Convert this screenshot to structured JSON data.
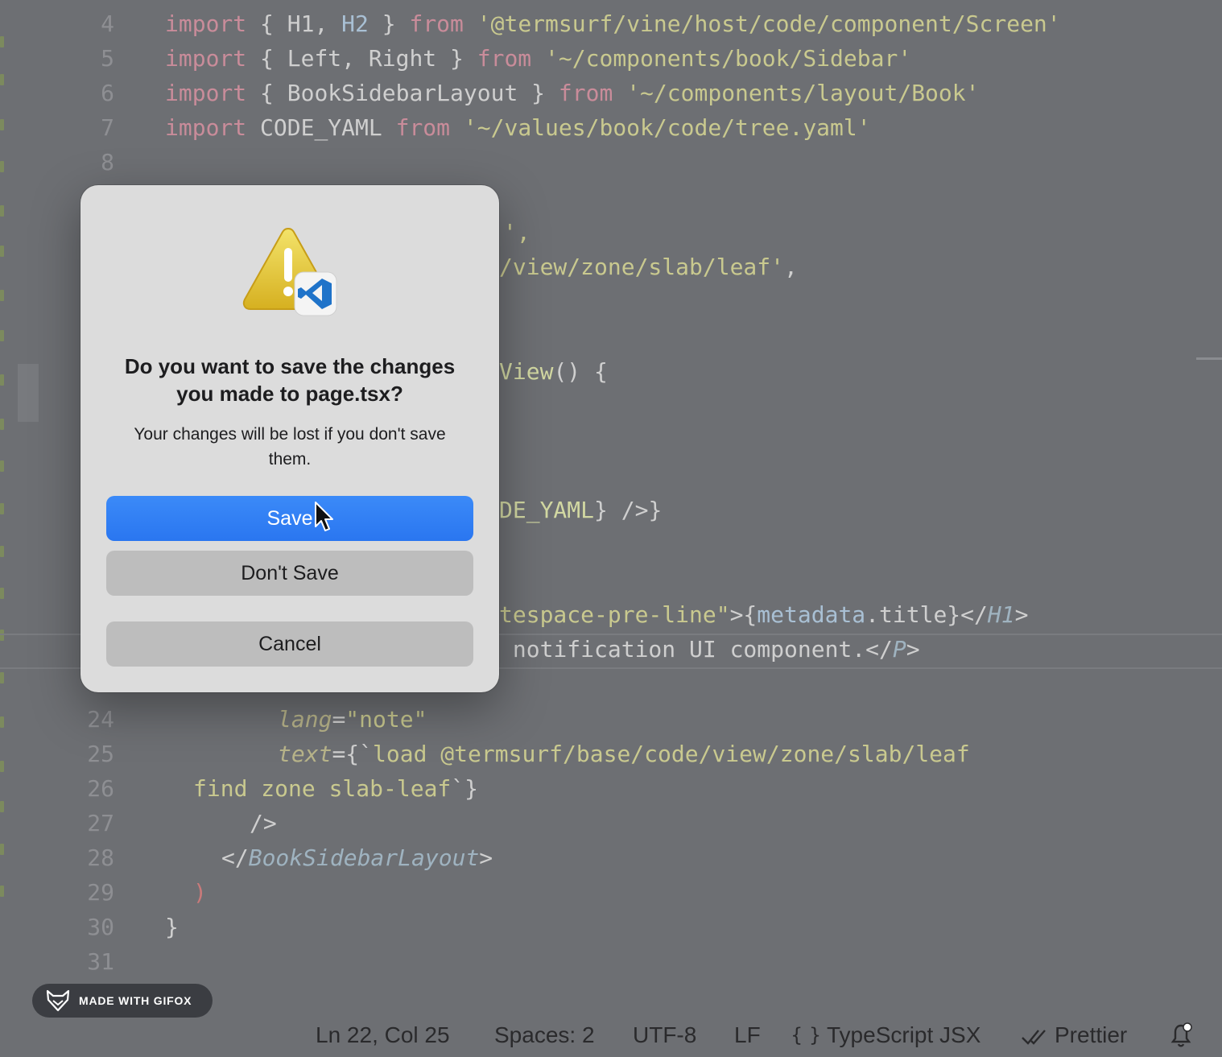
{
  "editor": {
    "lines": [
      {
        "num": "4",
        "segments": [
          [
            "kw",
            "import"
          ],
          [
            "plain",
            " { H1, "
          ],
          [
            "obj",
            "H2"
          ],
          [
            "plain",
            " } "
          ],
          [
            "kw",
            "from"
          ],
          [
            "plain",
            " "
          ],
          [
            "str",
            "'@termsurf/vine/host/code/component/Screen'"
          ]
        ]
      },
      {
        "num": "5",
        "segments": [
          [
            "kw",
            "import"
          ],
          [
            "plain",
            " { Left, Right } "
          ],
          [
            "kw",
            "from"
          ],
          [
            "plain",
            " "
          ],
          [
            "str",
            "'~/components/book/Sidebar'"
          ]
        ]
      },
      {
        "num": "6",
        "segments": [
          [
            "kw",
            "import"
          ],
          [
            "plain",
            " { BookSidebarLayout } "
          ],
          [
            "kw",
            "from"
          ],
          [
            "plain",
            " "
          ],
          [
            "str",
            "'~/components/layout/Book'"
          ]
        ]
      },
      {
        "num": "7",
        "segments": [
          [
            "kw",
            "import"
          ],
          [
            "plain",
            " CODE_YAML "
          ],
          [
            "kw",
            "from"
          ],
          [
            "plain",
            " "
          ],
          [
            "str",
            "'~/values/book/code/tree.yaml'"
          ]
        ]
      },
      {
        "num": "8",
        "segments": []
      },
      {
        "num": "",
        "segments": [
          [
            "str",
            "',"
          ]
        ],
        "indent": 420
      },
      {
        "num": "",
        "segments": [
          [
            "str",
            "/view/zone/slab/leaf'"
          ],
          [
            "plain",
            ","
          ]
        ],
        "indent": 415
      },
      {
        "num": "",
        "segments": [
          [
            "fn",
            "View"
          ],
          [
            "plain",
            "() {"
          ]
        ],
        "indent": 415
      },
      {
        "num": "",
        "segments": [
          [
            "fn",
            "DE_YAML"
          ],
          [
            "plain",
            "} />}"
          ]
        ],
        "indent": 415
      },
      {
        "num": "",
        "segments": [
          [
            "str",
            "tespace-pre-line\""
          ],
          [
            "plain",
            ">{"
          ],
          [
            "obj",
            "metadata"
          ],
          [
            "plain",
            ".title}</"
          ],
          [
            "tag",
            "H1"
          ],
          [
            "plain",
            ">"
          ]
        ],
        "indent": 415
      },
      {
        "num": "",
        "segments": [
          [
            "plain",
            " notification UI component.</"
          ],
          [
            "tag",
            "P"
          ],
          [
            "plain",
            ">"
          ]
        ],
        "indent": 415
      },
      {
        "num": "24",
        "segments": [
          [
            "attr",
            "lang"
          ],
          [
            "plain",
            "="
          ],
          [
            "str",
            "\"note\""
          ]
        ],
        "indent": 140
      },
      {
        "num": "25",
        "segments": [
          [
            "attr",
            "text"
          ],
          [
            "plain",
            "={`"
          ],
          [
            "str",
            "load @termsurf/base/code/view/zone/slab/leaf"
          ]
        ],
        "indent": 140
      },
      {
        "num": "26",
        "segments": [
          [
            "str",
            "find zone slab-leaf"
          ],
          [
            "plain",
            "`}"
          ]
        ],
        "indent": 35
      },
      {
        "num": "27",
        "segments": [
          [
            "plain",
            "/>"
          ]
        ],
        "indent": 105
      },
      {
        "num": "28",
        "segments": [
          [
            "plain",
            "</"
          ],
          [
            "tag",
            "BookSidebarLayout"
          ],
          [
            "plain",
            ">"
          ]
        ],
        "indent": 70
      },
      {
        "num": "29",
        "segments": [
          [
            "red",
            ")"
          ]
        ],
        "indent": 35
      },
      {
        "num": "30",
        "segments": [
          [
            "plain",
            "}"
          ]
        ]
      },
      {
        "num": "31",
        "segments": []
      }
    ]
  },
  "dialog": {
    "icon": "warning-with-vscode-icon",
    "title": "Do you want to save the changes you made to page.tsx?",
    "message": "Your changes will be lost if you don't save them.",
    "save_label": "Save",
    "dont_save_label": "Don't Save",
    "cancel_label": "Cancel",
    "accent": "#2a76f0"
  },
  "statusbar": {
    "position": "Ln 22, Col 25",
    "spaces": "Spaces: 2",
    "encoding": "UTF-8",
    "eol": "LF",
    "language_icon": "{ }",
    "language": "TypeScript JSX",
    "formatter_icon": "double-check-icon",
    "formatter": "Prettier",
    "notifications_icon": "bell-icon"
  },
  "watermark": {
    "text": "MADE WITH GIFOX",
    "icon": "fox-icon"
  }
}
